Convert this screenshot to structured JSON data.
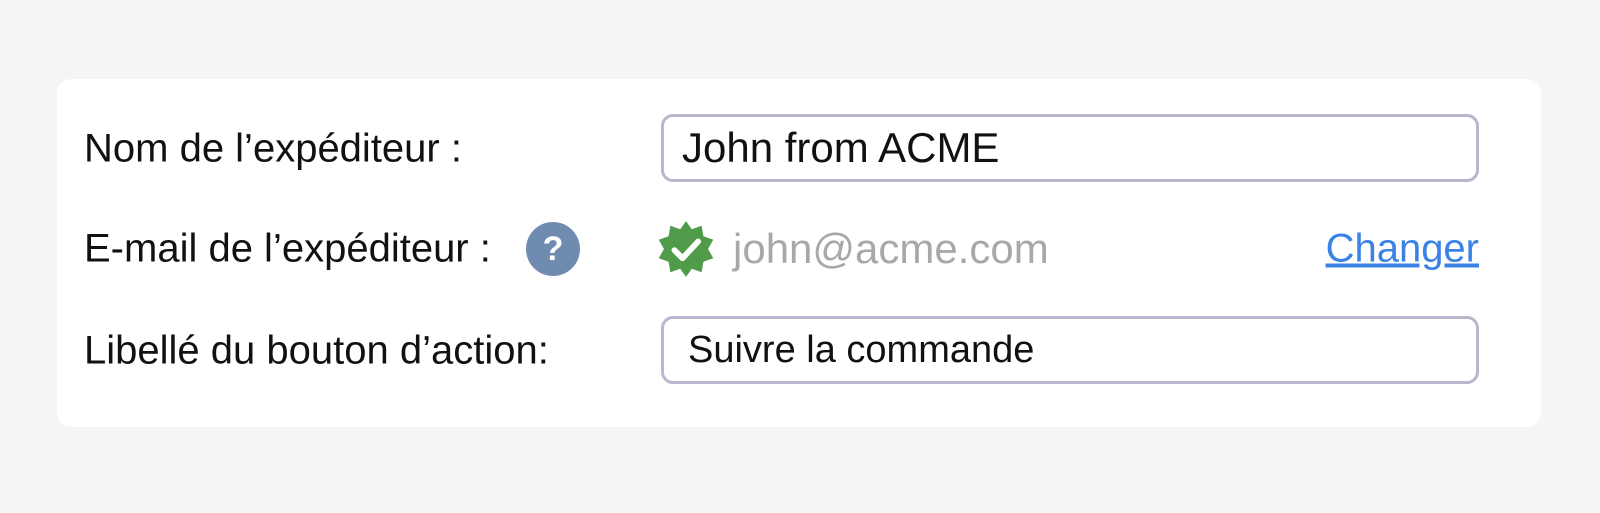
{
  "form": {
    "sender_name": {
      "label": "Nom de l’expéditeur :",
      "value": "John from ACME"
    },
    "sender_email": {
      "label": "E-mail de l’expéditeur :",
      "help_icon_text": "?",
      "verified_icon": "verified-badge-icon",
      "value": "john@acme.com",
      "change_link": "Changer"
    },
    "action_button_label": {
      "label": "Libellé du bouton d’action:",
      "value": "Suivre la commande"
    }
  },
  "colors": {
    "background": "#f5f5f5",
    "card": "#ffffff",
    "input_border": "#b9b7cc",
    "help_icon": "#6f8bb0",
    "verified_green": "#4f9b4a",
    "email_text": "#a8a8a8",
    "link": "#3b82e6"
  }
}
